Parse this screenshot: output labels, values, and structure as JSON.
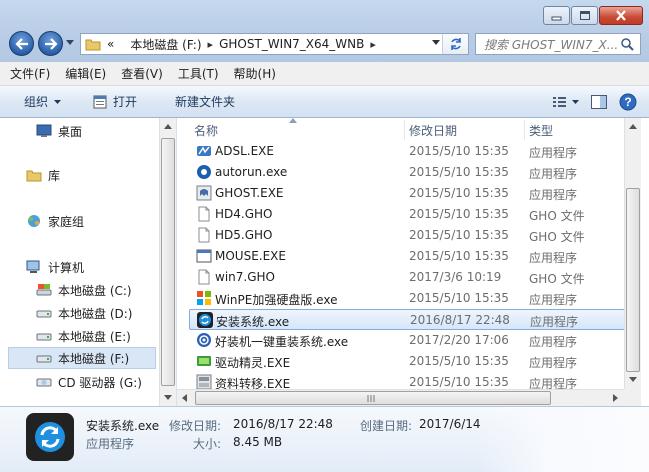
{
  "window": {
    "minimize_icon": "minimize-icon",
    "maximize_icon": "maximize-icon",
    "close_icon": "close-icon"
  },
  "address": {
    "prefix": "«",
    "crumbs": [
      "本地磁盘 (F:)",
      "GHOST_WIN7_X64_WNB"
    ]
  },
  "search": {
    "placeholder": "搜索 GHOST_WIN7_X..."
  },
  "menu": [
    "文件(F)",
    "编辑(E)",
    "查看(V)",
    "工具(T)",
    "帮助(H)"
  ],
  "toolbar": {
    "organize": "组织",
    "open": "打开",
    "new_folder": "新建文件夹"
  },
  "nav": {
    "desktop": "桌面",
    "libraries": "库",
    "homegroup": "家庭组",
    "computer": "计算机",
    "drives": [
      "本地磁盘 (C:)",
      "本地磁盘 (D:)",
      "本地磁盘 (E:)",
      "本地磁盘 (F:)",
      "CD 驱动器 (G:)"
    ]
  },
  "columns": {
    "name": "名称",
    "modified": "修改日期",
    "type": "类型"
  },
  "files": [
    {
      "name": "ADSL.EXE",
      "date": "2015/5/10 15:35",
      "type": "应用程序",
      "icon": "adsl-icon"
    },
    {
      "name": "autorun.exe",
      "date": "2015/5/10 15:35",
      "type": "应用程序",
      "icon": "autorun-icon"
    },
    {
      "name": "GHOST.EXE",
      "date": "2015/5/10 15:35",
      "type": "应用程序",
      "icon": "ghost-icon"
    },
    {
      "name": "HD4.GHO",
      "date": "2015/5/10 15:35",
      "type": "GHO 文件",
      "icon": "file-icon"
    },
    {
      "name": "HD5.GHO",
      "date": "2015/5/10 15:35",
      "type": "GHO 文件",
      "icon": "file-icon"
    },
    {
      "name": "MOUSE.EXE",
      "date": "2015/5/10 15:35",
      "type": "应用程序",
      "icon": "app-window-icon"
    },
    {
      "name": "win7.GHO",
      "date": "2017/3/6 10:19",
      "type": "GHO 文件",
      "icon": "file-icon"
    },
    {
      "name": "WinPE加强硬盘版.exe",
      "date": "2015/5/10 15:35",
      "type": "应用程序",
      "icon": "winpe-icon"
    },
    {
      "name": "安装系统.exe",
      "date": "2016/8/17 22:48",
      "type": "应用程序",
      "icon": "install-icon"
    },
    {
      "name": "好装机一键重装系统.exe",
      "date": "2017/2/20 17:06",
      "type": "应用程序",
      "icon": "reinstall-icon"
    },
    {
      "name": "驱动精灵.EXE",
      "date": "2015/5/10 15:35",
      "type": "应用程序",
      "icon": "driver-icon"
    },
    {
      "name": "资料转移.EXE",
      "date": "2015/5/10 15:35",
      "type": "应用程序",
      "icon": "transfer-icon"
    }
  ],
  "selected_index": 8,
  "details": {
    "name": "安装系统.exe",
    "type": "应用程序",
    "modified_label": "修改日期:",
    "modified_value": "2016/8/17 22:48",
    "created_label": "创建日期:",
    "created_value": "2017/6/14",
    "size_label": "大小:",
    "size_value": "8.45 MB"
  }
}
